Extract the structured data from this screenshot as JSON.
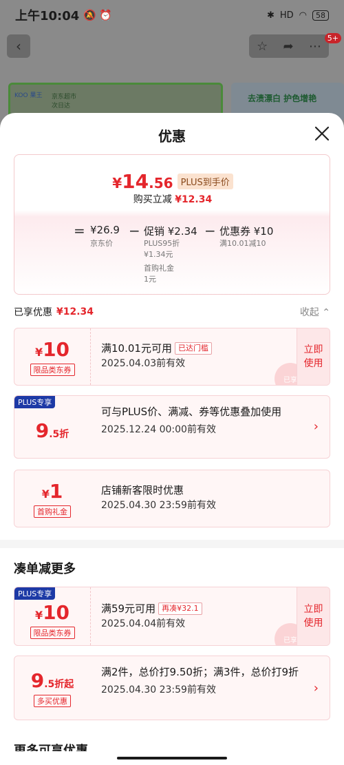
{
  "status": {
    "time": "上午10:04",
    "battery": "58",
    "signal": "HD"
  },
  "background": {
    "banner_left_brand": "KOO 果王",
    "banner_left_text": "京东超市 次日达",
    "banner_right_text": "去渍漂白 护色增艳",
    "notif_count": "5+"
  },
  "sheet": {
    "title": "优惠",
    "summary": {
      "currency": "¥",
      "price_int": "14",
      "price_dec": ".56",
      "plus_tag": "PLUS到手价",
      "sub_label": "购买立减",
      "sub_amount": "¥12.34",
      "eq": "=",
      "base_price": "¥26.9",
      "base_note": "京东价",
      "minus1": "−",
      "promo_label": "促销 ¥2.34",
      "promo_note1": "PLUS95折",
      "promo_note2": "¥1.34元",
      "promo_note3": "首购礼金",
      "promo_note4": "1元",
      "minus2": "−",
      "coupon_label": "优惠券 ¥10",
      "coupon_note": "满10.01减10"
    },
    "enjoyed": {
      "label": "已享优惠",
      "amount": "¥12.34",
      "collapse": "收起 ⌃"
    },
    "cards": [
      {
        "amount_sym": "¥",
        "amount": "10",
        "tag": "限品类东券",
        "title": "满10.01元可用",
        "mini_tag": "已达门槛",
        "date": "2025.04.03前有效",
        "action": "立即\n使用",
        "stamp": "已享"
      },
      {
        "badge": "PLUS专享",
        "amount": "9",
        "amount_unit": ".5折",
        "title": "可与PLUS价、满减、券等优惠叠加使用",
        "date": "2025.12.24 00:00前有效",
        "chev": "›"
      },
      {
        "amount_sym": "¥",
        "amount": "1",
        "tag": "首购礼金",
        "title": "店铺新客限时优惠",
        "date": "2025.04.30 23:59前有效"
      }
    ],
    "more_section": {
      "title": "凑单减更多",
      "cards": [
        {
          "badge": "PLUS专享",
          "amount_sym": "¥",
          "amount": "10",
          "tag": "限品类东券",
          "title": "满59元可用",
          "mini_tag": "再凑¥32.1",
          "date": "2025.04.04前有效",
          "action": "立即\n使用",
          "stamp": "已享"
        },
        {
          "amount": "9",
          "amount_unit": ".5折起",
          "tag": "多买优惠",
          "title": "满2件，总价打9.50折；满3件，总价打9折",
          "date": "2025.04.30 23:59前有效",
          "chev": "›"
        }
      ]
    },
    "next_section_title": "更多可享优惠"
  },
  "colors": {
    "accent_red": "#e4262c",
    "plus_blue": "#1d3aa6",
    "card_bg": "#fff6f6"
  }
}
